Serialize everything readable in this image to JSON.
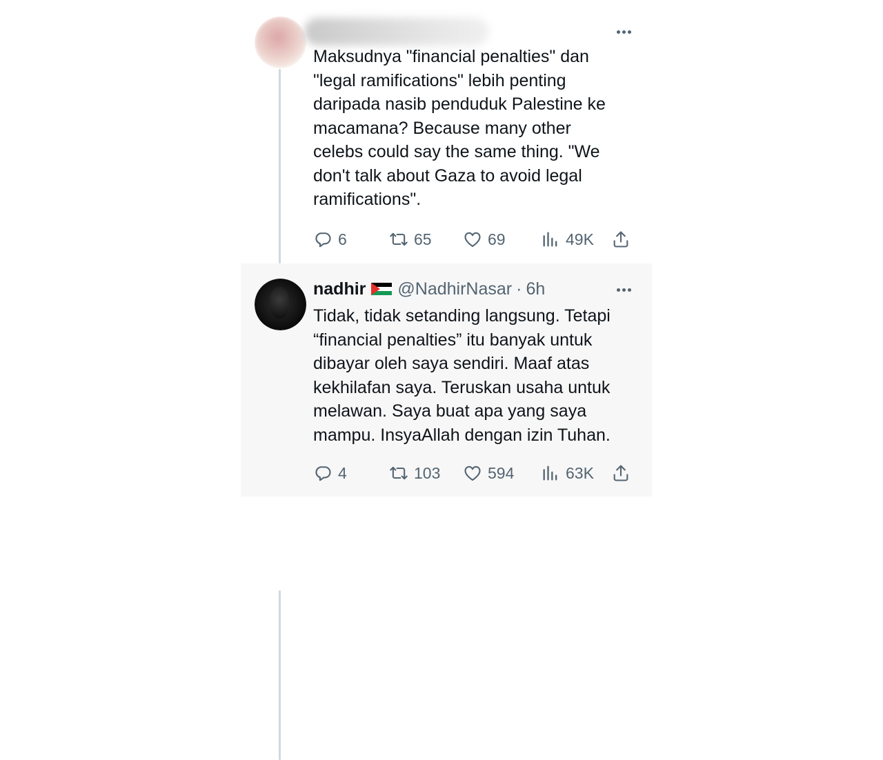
{
  "thread": {
    "tweets": [
      {
        "author": {
          "name_blurred": true
        },
        "text_lines": [
          "Maksudnya \"financial penalties\" dan",
          "\"legal ramifications\" lebih penting",
          "daripada nasib penduduk Palestine ke",
          "macamana? Because many other",
          "celebs could say the same thing. \"We",
          "don't talk about Gaza to avoid legal",
          "ramifications\"."
        ],
        "stats": {
          "replies": "6",
          "retweets": "65",
          "likes": "69",
          "views": "49K"
        }
      },
      {
        "author": {
          "name": "nadhir",
          "handle": "@NadhirNasar",
          "separator": "·",
          "time": "6h",
          "flag": "palestine-flag"
        },
        "text_lines": [
          "Tidak, tidak setanding langsung. Tetapi",
          "“financial penalties” itu banyak untuk",
          "dibayar oleh saya sendiri. Maaf atas",
          "kekhilafan saya. Teruskan usaha untuk",
          "melawan. Saya buat apa yang saya",
          "mampu. InsyaAllah dengan izin Tuhan."
        ],
        "stats": {
          "replies": "4",
          "retweets": "103",
          "likes": "594",
          "views": "63K"
        }
      }
    ]
  },
  "colors": {
    "text": "#0f1419",
    "secondary": "#536471",
    "thread_line": "#cfd9de",
    "highlight_bg": "#f7f7f7",
    "flag_black": "#000000",
    "flag_white": "#ffffff",
    "flag_green": "#149954",
    "flag_red": "#e4312b"
  },
  "icons": [
    "reply-icon",
    "retweet-icon",
    "like-icon",
    "views-icon",
    "share-icon",
    "more-icon",
    "palestine-flag-icon"
  ]
}
